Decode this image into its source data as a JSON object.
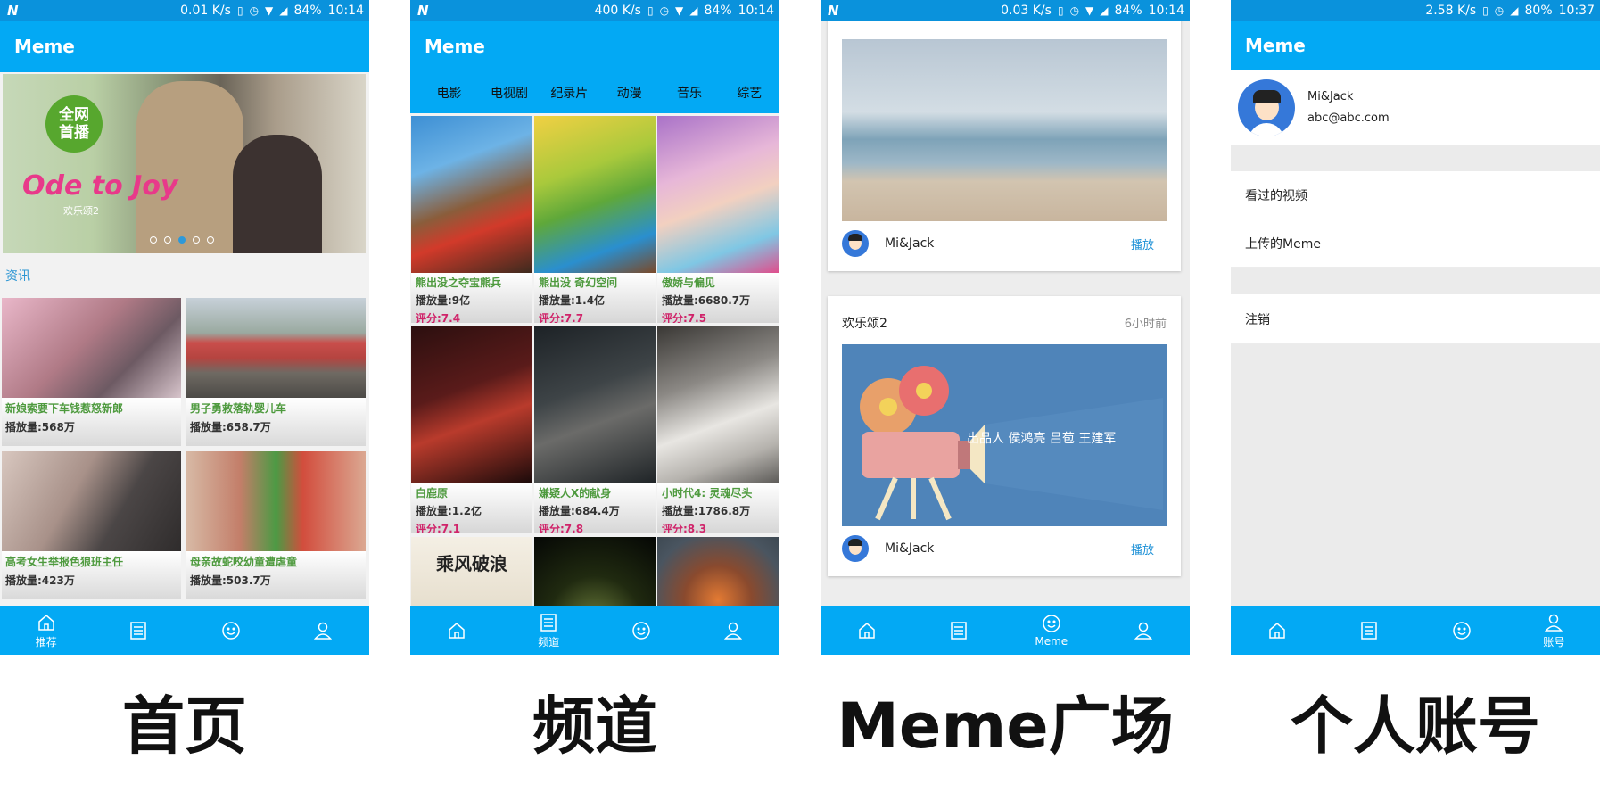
{
  "status_bars": [
    {
      "speed": "0.01 K/s",
      "battery": "84%",
      "time": "10:14"
    },
    {
      "speed": "400 K/s",
      "battery": "84%",
      "time": "10:14"
    },
    {
      "speed": "0.03 K/s",
      "battery": "84%",
      "time": "10:14"
    },
    {
      "speed": "2.58 K/s",
      "battery": "80%",
      "time": "10:37"
    }
  ],
  "app_title": "Meme",
  "nav_labels": {
    "home": "推荐",
    "channel": "频道",
    "meme": "Meme",
    "account": "账号"
  },
  "home": {
    "banner": {
      "badge_line1": "全网",
      "badge_line2": "首播",
      "title": "Ode to Joy",
      "subtitle": "欢乐颂2"
    },
    "section_label": "资讯",
    "news": [
      {
        "title": "新娘索要下车钱惹怒新郎",
        "plays": "播放量:568万"
      },
      {
        "title": "男子勇救落轨婴儿车",
        "plays": "播放量:658.7万"
      },
      {
        "title": "高考女生举报色狼班主任",
        "plays": "播放量:423万"
      },
      {
        "title": "母亲故蛇咬幼童遭虐童",
        "plays": "播放量:503.7万"
      }
    ]
  },
  "channel": {
    "tabs": [
      "电影",
      "电视剧",
      "纪录片",
      "动漫",
      "音乐",
      "综艺"
    ],
    "movies": [
      {
        "title": "熊出没之夺宝熊兵",
        "plays": "播放量:9亿",
        "score": "评分:7.4"
      },
      {
        "title": "熊出没 奇幻空间",
        "plays": "播放量:1.4亿",
        "score": "评分:7.7"
      },
      {
        "title": "傲娇与偏见",
        "plays": "播放量:6680.7万",
        "score": "评分:7.5"
      },
      {
        "title": "白鹿原",
        "plays": "播放量:1.2亿",
        "score": "评分:7.1"
      },
      {
        "title": "嫌疑人X的献身",
        "plays": "播放量:684.4万",
        "score": "评分:7.8"
      },
      {
        "title": "小时代4: 灵魂尽头",
        "plays": "播放量:1786.8万",
        "score": "评分:8.3"
      },
      {
        "poster_text": "乘风破浪"
      },
      {
        "poster_text": ""
      },
      {
        "poster_text": ""
      }
    ]
  },
  "meme": {
    "cards": [
      {
        "title": "",
        "time": "",
        "user": "Mi&Jack",
        "play": "播放"
      },
      {
        "title": "欢乐颂2",
        "time": "6小时前",
        "user": "Mi&Jack",
        "play": "播放",
        "image_text": "出品人  侯鸿亮 吕苞 王建军"
      }
    ]
  },
  "account": {
    "name": "Mi&Jack",
    "email": "abc@abc.com",
    "menu": [
      "看过的视频",
      "上传的Meme",
      "注销"
    ]
  },
  "captions": [
    "首页",
    "频道",
    "Meme广场",
    "个人账号"
  ],
  "colors": {
    "primary": "#03a9f4",
    "status": "#0a92dc",
    "green_text": "#4e9a3e",
    "score": "#d0246a",
    "link": "#1a8fd6"
  }
}
